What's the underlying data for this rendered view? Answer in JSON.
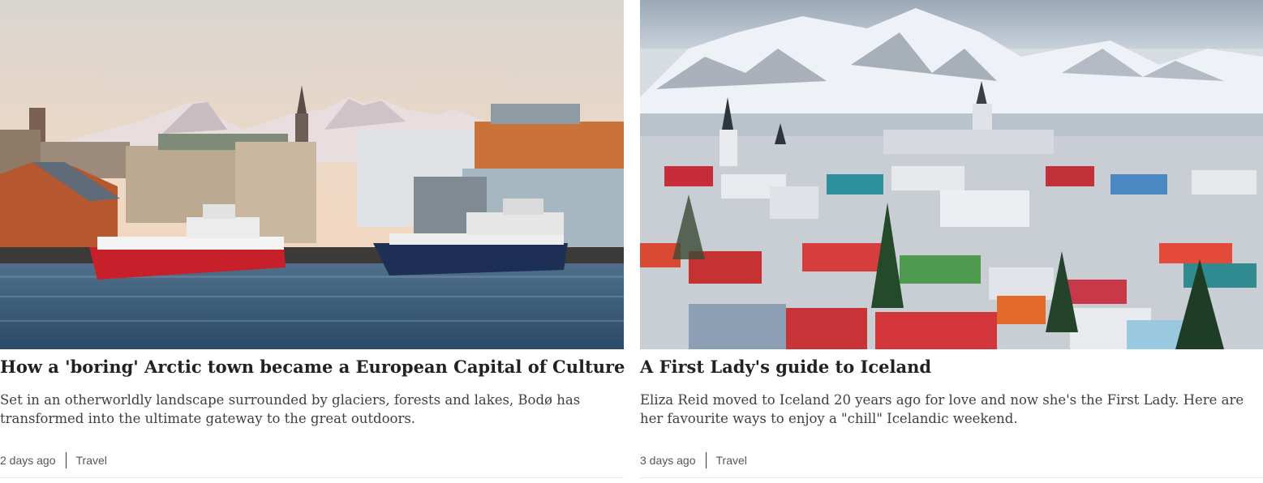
{
  "cards": [
    {
      "headline": "How a 'boring' Arctic town became a European Capital of Culture",
      "summary": "Set in an otherworldly landscape surrounded by glaciers, forests and lakes, Bodø has transformed into the ultimate gateway to the great outdoors.",
      "timestamp": "2 days ago",
      "category": "Travel"
    },
    {
      "headline": "A First Lady's guide to Iceland",
      "summary": "Eliza Reid moved to Iceland 20 years ago for love and now she's the First Lady. Here are her favourite ways to enjoy a \"chill\" Icelandic weekend.",
      "timestamp": "3 days ago",
      "category": "Travel"
    }
  ]
}
